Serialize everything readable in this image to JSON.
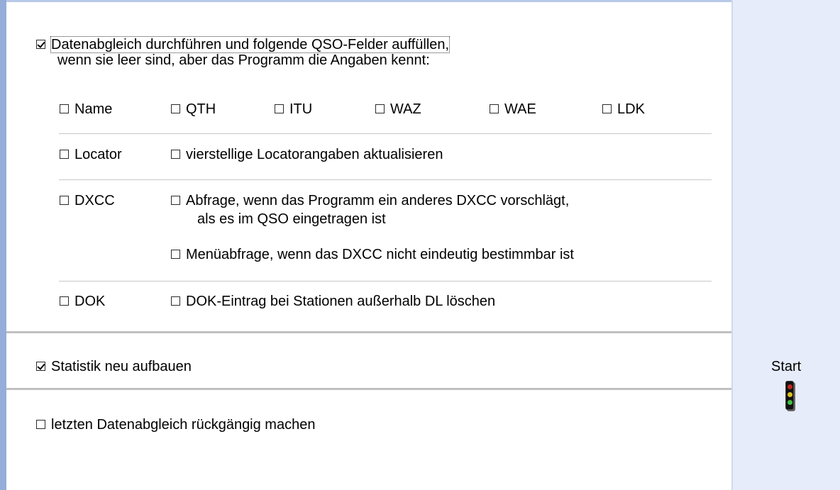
{
  "main": {
    "datenabgleich": {
      "checked": true,
      "label_line1": "Datenabgleich durchführen und folgende QSO-Felder auffüllen,",
      "label_line2": "wenn sie leer sind, aber das Programm die Angaben kennt:"
    },
    "fields": {
      "name": {
        "label": "Name",
        "checked": false
      },
      "qth": {
        "label": "QTH",
        "checked": false
      },
      "itu": {
        "label": "ITU",
        "checked": false
      },
      "waz": {
        "label": "WAZ",
        "checked": false
      },
      "wae": {
        "label": "WAE",
        "checked": false
      },
      "ldk": {
        "label": "LDK",
        "checked": false
      }
    },
    "locator": {
      "label": "Locator",
      "checked": false,
      "option": {
        "label": "vierstellige Locatorangaben aktualisieren",
        "checked": false
      }
    },
    "dxcc": {
      "label": "DXCC",
      "checked": false,
      "option1": {
        "label_line1": "Abfrage, wenn das Programm ein anderes DXCC vorschlägt,",
        "label_line2": "als es im QSO eingetragen ist",
        "checked": false
      },
      "option2": {
        "label": "Menüabfrage, wenn das DXCC nicht eindeutig bestimmbar ist",
        "checked": false
      }
    },
    "dok": {
      "label": "DOK",
      "checked": false,
      "option": {
        "label": "DOK-Eintrag bei Stationen außerhalb DL löschen",
        "checked": false
      }
    },
    "statistik": {
      "label": "Statistik neu aufbauen",
      "checked": true
    },
    "rueckgaengig": {
      "label": "letzten Datenabgleich rückgängig machen",
      "checked": false
    }
  },
  "sidebar": {
    "start_label": "Start",
    "traffic_light_icon": "traffic-light-icon",
    "lamp_colors": {
      "red": "#c0281e",
      "yellow": "#d8c020",
      "green": "#40c040"
    }
  },
  "colors": {
    "frame_left": "#95add9",
    "panel_bg": "#e6ecf9"
  }
}
